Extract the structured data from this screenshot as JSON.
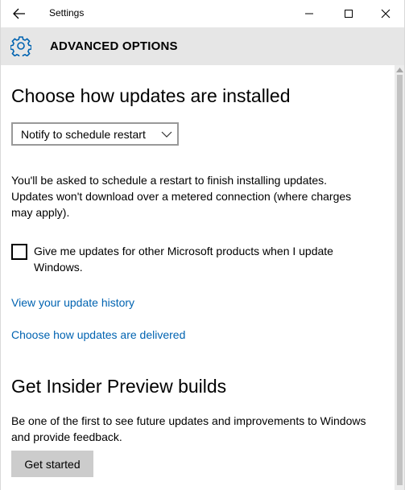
{
  "window": {
    "title": "Settings"
  },
  "header": {
    "title": "ADVANCED OPTIONS",
    "icon": "gear-icon",
    "accent_color": "#0063b1"
  },
  "updates_section": {
    "heading": "Choose how updates are installed",
    "dropdown_selected": "Notify to schedule restart",
    "description_lines": [
      "You'll be asked to schedule a restart to finish installing updates.",
      "Updates won't download over a metered connection (where charges",
      "may apply)."
    ],
    "checkbox_label_lines": [
      "Give me updates for other Microsoft products when I update",
      "Windows."
    ],
    "checkbox_checked": false,
    "link_history": "View your update history",
    "link_delivery": "Choose how updates are delivered"
  },
  "insider_section": {
    "heading": "Get Insider Preview builds",
    "description_lines": [
      "Be one of the first to see future updates and improvements to Windows",
      "and provide feedback."
    ],
    "button_label": "Get started"
  },
  "colors": {
    "link": "#0063b1",
    "header_bg": "#e6e6e6",
    "button_bg": "#cccccc"
  }
}
